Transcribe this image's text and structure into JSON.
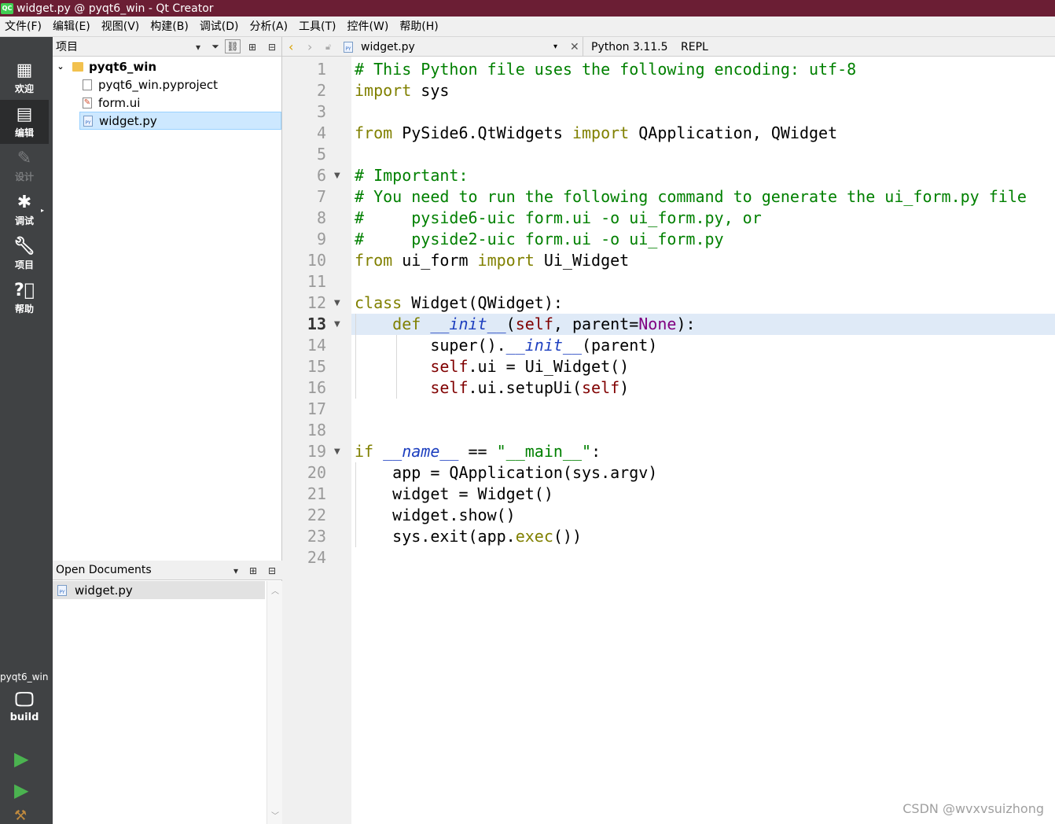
{
  "window": {
    "title": "widget.py @ pyqt6_win - Qt Creator",
    "logo_text": "QC"
  },
  "menubar": {
    "items": [
      "文件(F)",
      "编辑(E)",
      "视图(V)",
      "构建(B)",
      "调试(D)",
      "分析(A)",
      "工具(T)",
      "控件(W)",
      "帮助(H)"
    ]
  },
  "modes": {
    "welcome": "欢迎",
    "edit": "编辑",
    "design": "设计",
    "debug": "调试",
    "project": "项目",
    "help": "帮助",
    "kit_label": "pyqt6_win",
    "build_label": "build"
  },
  "project_panel": {
    "title": "项目",
    "root": "pyqt6_win",
    "files": [
      "pyqt6_win.pyproject",
      "form.ui",
      "widget.py"
    ],
    "selected_file": "widget.py"
  },
  "open_documents": {
    "title": "Open Documents",
    "items": [
      "widget.py"
    ]
  },
  "editor": {
    "file_name": "widget.py",
    "python_label": "Python 3.11.5",
    "repl_label": "REPL",
    "current_line": 13,
    "lines": [
      "# This Python file uses the following encoding: utf-8",
      "import sys",
      "",
      "from PySide6.QtWidgets import QApplication, QWidget",
      "",
      "# Important:",
      "# You need to run the following command to generate the ui_form.py file",
      "#     pyside6-uic form.ui -o ui_form.py, or",
      "#     pyside2-uic form.ui -o ui_form.py",
      "from ui_form import Ui_Widget",
      "",
      "class Widget(QWidget):",
      "    def __init__(self, parent=None):",
      "        super().__init__(parent)",
      "        self.ui = Ui_Widget()",
      "        self.ui.setupUi(self)",
      "",
      "",
      "if __name__ == \"__main__\":",
      "    app = QApplication(sys.argv)",
      "    widget = Widget()",
      "    widget.show()",
      "    sys.exit(app.exec())",
      ""
    ],
    "line_numbers": [
      "1",
      "2",
      "3",
      "4",
      "5",
      "6",
      "7",
      "8",
      "9",
      "10",
      "11",
      "12",
      "13",
      "14",
      "15",
      "16",
      "17",
      "18",
      "19",
      "20",
      "21",
      "22",
      "23",
      "24"
    ]
  },
  "watermark": "CSDN @wvxvsuizhong"
}
